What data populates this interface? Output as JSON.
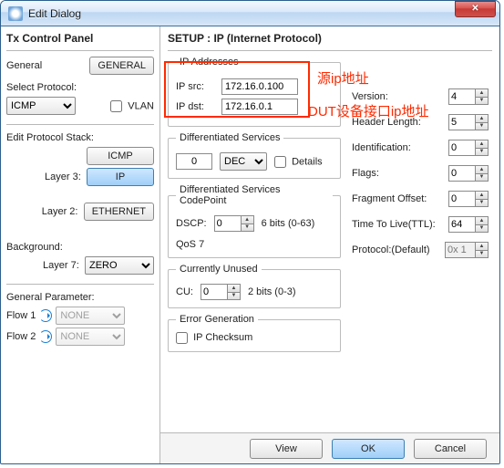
{
  "window": {
    "title": "Edit Dialog"
  },
  "left": {
    "title": "Tx Control Panel",
    "general_label": "General",
    "general_btn": "GENERAL",
    "select_protocol_label": "Select Protocol:",
    "protocol_value": "ICMP",
    "vlan_label": "VLAN",
    "edit_stack_label": "Edit Protocol Stack:",
    "icmp_btn": "ICMP",
    "layer3_label": "Layer 3:",
    "ip_btn": "IP",
    "layer2_label": "Layer 2:",
    "ethernet_btn": "ETHERNET",
    "background_label": "Background:",
    "layer7_label": "Layer 7:",
    "layer7_value": "ZERO",
    "gen_param_label": "General Parameter:",
    "flow1_label": "Flow 1",
    "flow2_label": "Flow 2",
    "none_value": "NONE"
  },
  "right": {
    "title": "SETUP : IP (Internet Protocol)",
    "ip_addresses_legend": "IP Addresses",
    "ip_src_label": "IP src:",
    "ip_src_value": "172.16.0.100",
    "ip_dst_label": "IP dst:",
    "ip_dst_value": "172.16.0.1",
    "annot_src": "源ip地址",
    "annot_dst": "DUT设备接口ip地址",
    "diff_serv_legend": "Differentiated Services",
    "diff_serv_value": "0",
    "diff_serv_mode": "DEC",
    "details_label": "Details",
    "dscp_legend": "Differentiated Services CodePoint",
    "dscp_label": "DSCP:",
    "dscp_value": "0",
    "dscp_bits": "6 bits (0-63)",
    "qos_label": "QoS 7",
    "cu_legend": "Currently Unused",
    "cu_label": "CU:",
    "cu_value": "0",
    "cu_bits": "2 bits (0-3)",
    "err_legend": "Error Generation",
    "ip_checksum_label": "IP Checksum",
    "rc": {
      "version_label": "Version:",
      "version_value": "4",
      "header_len_label": "Header Length:",
      "header_len_value": "5",
      "identification_label": "Identification:",
      "identification_value": "0",
      "flags_label": "Flags:",
      "flags_value": "0",
      "frag_label": "Fragment Offset:",
      "frag_value": "0",
      "ttl_label": "Time To Live(TTL):",
      "ttl_value": "64",
      "proto_label": "Protocol:(Default)",
      "proto_value": "0x 1"
    }
  },
  "buttons": {
    "view": "View",
    "ok": "OK",
    "cancel": "Cancel"
  }
}
